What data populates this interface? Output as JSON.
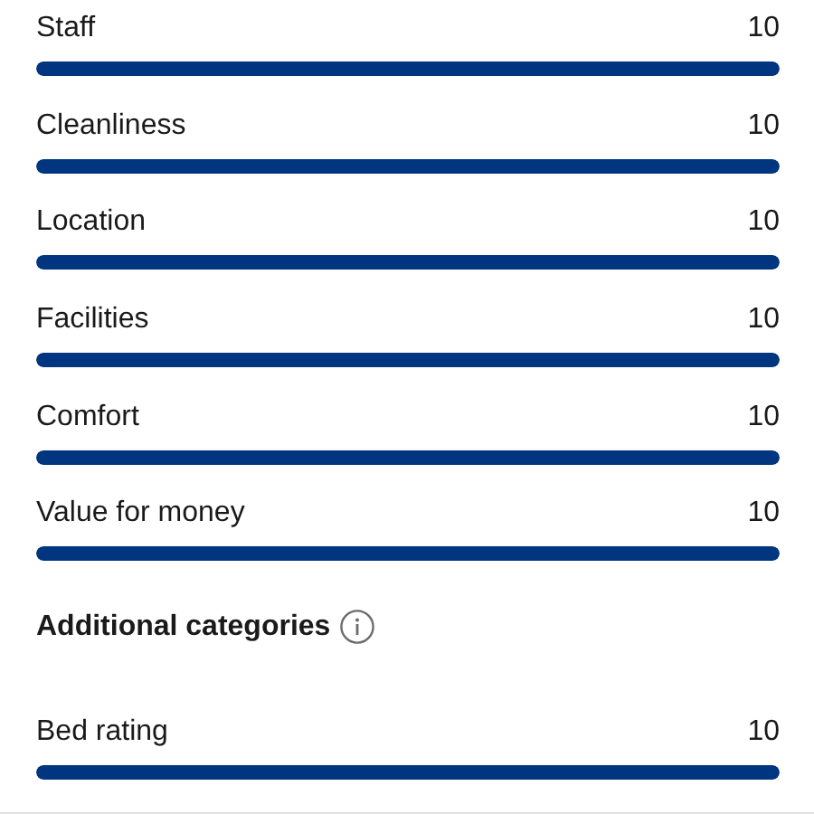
{
  "ratings": [
    {
      "label": "Staff",
      "score": "10",
      "level": 1
    },
    {
      "label": "Cleanliness",
      "score": "10",
      "level": 1
    },
    {
      "label": "Location",
      "score": "10",
      "level": 1
    },
    {
      "label": "Facilities",
      "score": "10",
      "level": 1
    },
    {
      "label": "Comfort",
      "score": "10",
      "level": 1
    },
    {
      "label": "Value for money",
      "score": "10",
      "level": 1
    }
  ],
  "additional": {
    "heading": "Additional categories",
    "ratings": [
      {
        "label": "Bed rating",
        "score": "10",
        "level": 1
      }
    ]
  }
}
